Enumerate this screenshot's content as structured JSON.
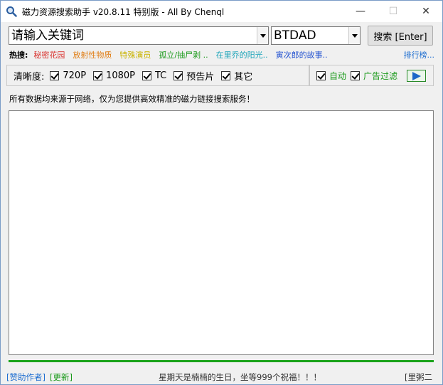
{
  "window": {
    "title": "磁力资源搜索助手 v20.8.11 特别版 - All By Chenql",
    "controls": {
      "minimize": "—",
      "maximize": "☐",
      "close": "✕"
    }
  },
  "search": {
    "keyword_value": "请输入关键词",
    "engine_value": "BTDAD",
    "search_button": "搜索 [Enter]"
  },
  "hot": {
    "label": "热搜:",
    "items": [
      {
        "text": "秘密花园",
        "color": "#d9302c"
      },
      {
        "text": "放射性物质",
        "color": "#e07b10"
      },
      {
        "text": "特殊演员",
        "color": "#c9b300"
      },
      {
        "text": "孤立/抽尸剥 ..",
        "color": "#1a9a1a"
      },
      {
        "text": "在里乔的阳光..",
        "color": "#1aa3b8"
      },
      {
        "text": "寅次郎的故事..",
        "color": "#2050d0"
      }
    ],
    "rank_link": "排行榜..."
  },
  "quality": {
    "label": "清晰度:",
    "options": [
      "720P",
      "1080P",
      "TC",
      "预告片",
      "其它"
    ]
  },
  "extras": {
    "auto_label": "自动",
    "ad_filter_label": "广告过滤"
  },
  "notice": "所有数据均来源于网络，仅为您提供高效精准的磁力链接搜索服务！",
  "progress": {
    "value": 1.0,
    "color": "#1aa31a"
  },
  "status": {
    "sponsor_link": "[赞助作者]",
    "update_link": "[更新]",
    "message": "星期天是楠楠的生日，坐等999个祝福！！！",
    "right_text": "[里粥二"
  }
}
